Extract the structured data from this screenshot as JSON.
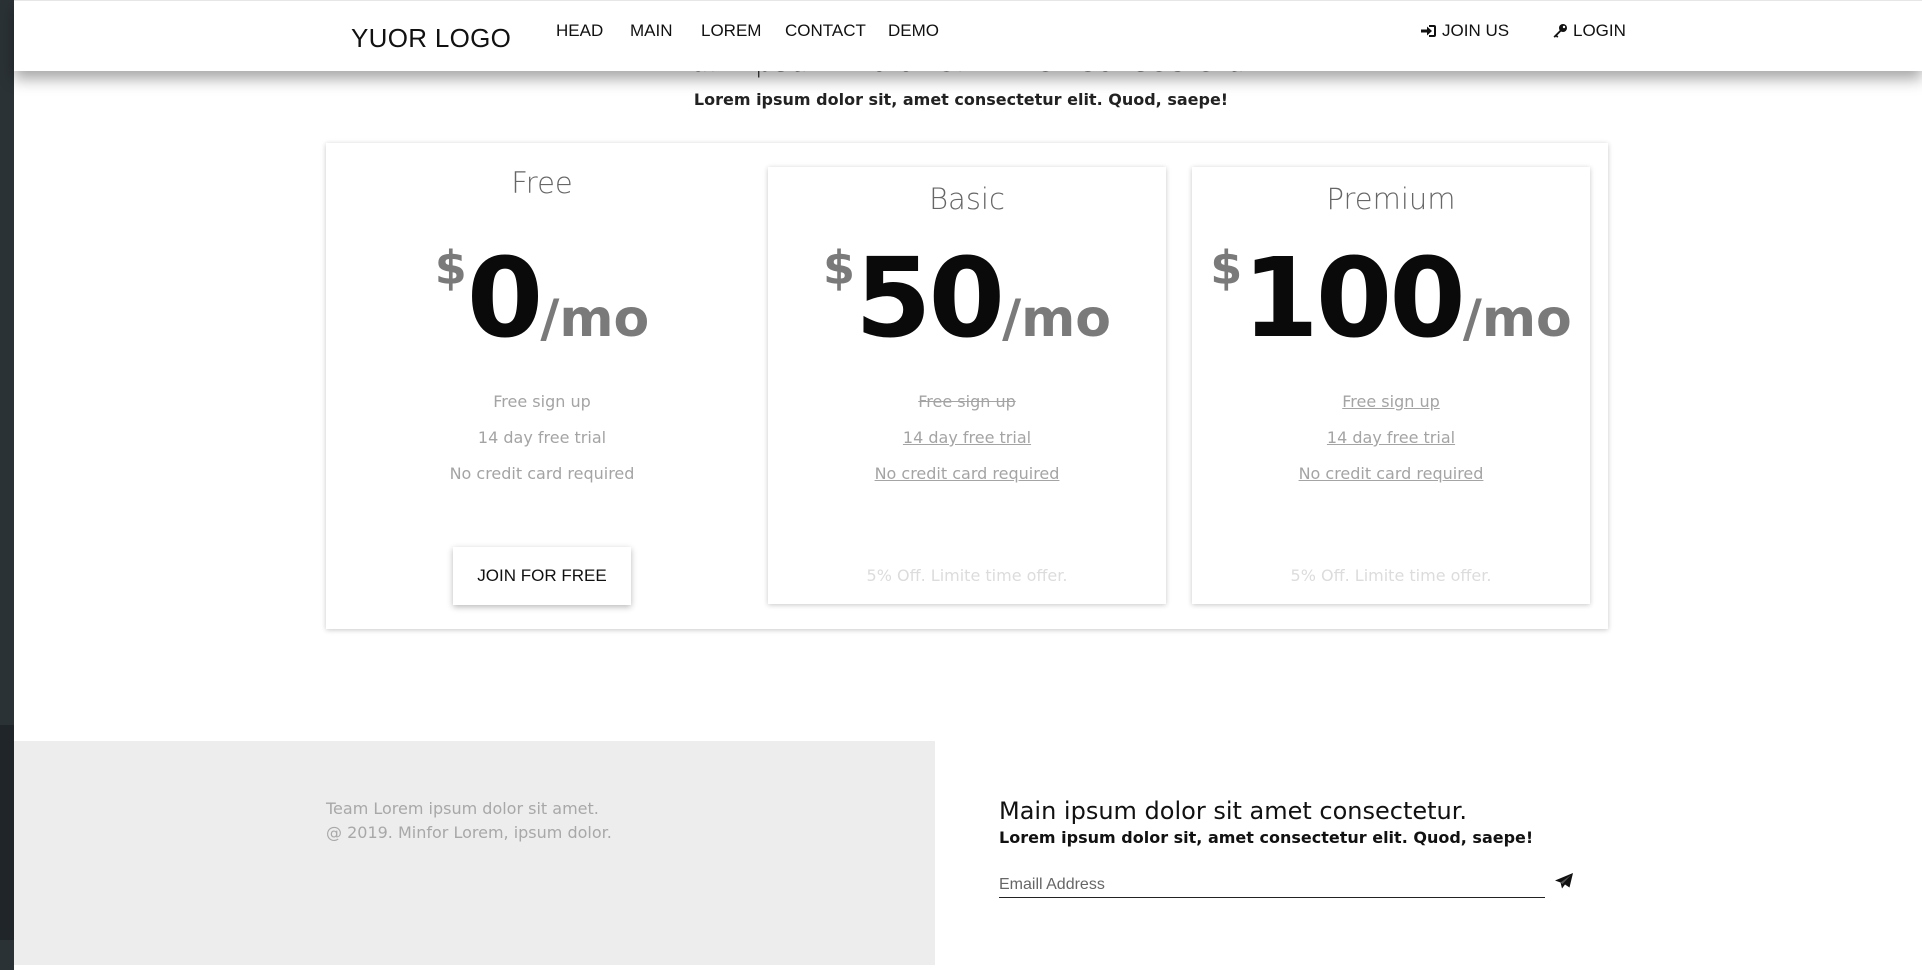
{
  "header": {
    "logo": "YUOR LOGO",
    "nav": [
      "HEAD",
      "MAIN",
      "LOREM",
      "CONTACT",
      "DEMO"
    ],
    "join_label": "JOIN US",
    "join_icon": "sign-in-icon",
    "login_label": "LOGIN",
    "login_icon": "key-icon"
  },
  "section": {
    "heading": "Main Ipsum Dolor Sit Amet Consectetur",
    "subheading": "Lorem ipsum dolor sit, amet consectetur elit. Quod, saepe!"
  },
  "pricing": [
    {
      "name": "Free",
      "currency": "$",
      "amount": "0",
      "period": "/mo",
      "features": [
        "Free sign up",
        "14 day free trial",
        "No credit card required"
      ],
      "button": "JOIN FOR FREE"
    },
    {
      "name": "Basic",
      "currency": "$",
      "amount": "50",
      "period": "/mo",
      "features": [
        "Free sign up",
        "14 day free trial",
        "No credit card required"
      ],
      "offer": "5% Off. Limite time offer."
    },
    {
      "name": "Premium",
      "currency": "$",
      "amount": "100",
      "period": "/mo",
      "features": [
        "Free sign up",
        "14 day free trial",
        "No credit card required"
      ],
      "offer": "5% Off. Limite time offer."
    }
  ],
  "footer": {
    "team_text": "Team Lorem ipsum dolor sit amet.",
    "copyright": "@ 2019. Minfor Lorem, ipsum dolor.",
    "newsletter_title": "Main ipsum dolor sit amet consectetur.",
    "newsletter_sub": "Lorem ipsum dolor sit, amet consectetur elit. Quod, saepe!",
    "email_placeholder": "Emaill Address",
    "send_icon": "paper-plane-icon"
  }
}
